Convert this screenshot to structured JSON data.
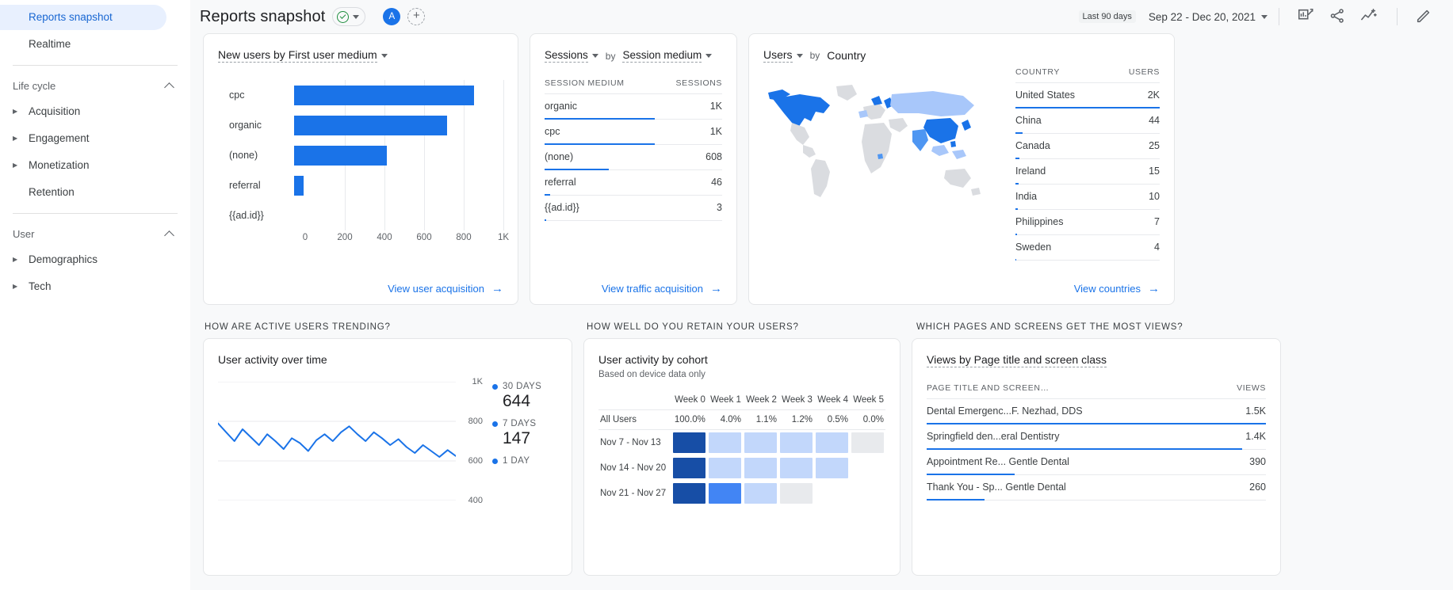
{
  "sidebar": {
    "top_items": [
      {
        "label": "Reports snapshot",
        "active": true,
        "expandable": false
      },
      {
        "label": "Realtime",
        "active": false,
        "expandable": false
      }
    ],
    "groups": [
      {
        "title": "Life cycle",
        "collapse_icon": "chevron-up-icon",
        "items": [
          {
            "label": "Acquisition",
            "expandable": true
          },
          {
            "label": "Engagement",
            "expandable": true
          },
          {
            "label": "Monetization",
            "expandable": true
          },
          {
            "label": "Retention",
            "expandable": false
          }
        ]
      },
      {
        "title": "User",
        "collapse_icon": "chevron-up-icon",
        "items": [
          {
            "label": "Demographics",
            "expandable": true
          },
          {
            "label": "Tech",
            "expandable": true
          }
        ]
      }
    ]
  },
  "header": {
    "title": "Reports snapshot",
    "badge_icon": "check-circle-icon",
    "badge_caret_icon": "triangle-down-icon",
    "avatar_initial": "A",
    "add_label": "+",
    "date_chip": "Last 90 days",
    "date_range": "Sep 22 - Dec 20, 2021",
    "date_caret_icon": "triangle-down-icon",
    "tools": [
      {
        "name": "compare-chart-icon"
      },
      {
        "name": "share-icon"
      },
      {
        "name": "insights-icon"
      },
      {
        "name": "edit-pencil-icon"
      }
    ]
  },
  "cards": {
    "new_users": {
      "title": "New users by First user medium",
      "caret_icon": "triangle-down-icon",
      "footer": "View user acquisition",
      "footer_arrow": "arrow-right-icon",
      "chart_data": {
        "type": "bar",
        "orientation": "horizontal",
        "title": "New users by First user medium",
        "xlabel": "",
        "ylabel": "",
        "categories": [
          "cpc",
          "organic",
          "(none)",
          "referral",
          "{{ad.id}}"
        ],
        "values": [
          860,
          730,
          445,
          47,
          0
        ],
        "xlim": [
          0,
          1000
        ],
        "xticks": [
          0,
          200,
          400,
          600,
          800,
          1000
        ],
        "xtick_labels": [
          "0",
          "200",
          "400",
          "600",
          "800",
          "1K"
        ],
        "grid": true,
        "color": "#1a73e8"
      }
    },
    "sessions": {
      "metric": "Sessions",
      "metric_caret_icon": "triangle-down-icon",
      "by": "by",
      "dimension": "Session medium",
      "dimension_caret_icon": "triangle-down-icon",
      "footer": "View traffic acquisition",
      "footer_arrow": "arrow-right-icon",
      "columns": [
        "SESSION MEDIUM",
        "SESSIONS"
      ],
      "rows": [
        {
          "label": "organic",
          "value": "1K",
          "pct": 62
        },
        {
          "label": "cpc",
          "value": "1K",
          "pct": 62
        },
        {
          "label": "(none)",
          "value": "608",
          "pct": 36
        },
        {
          "label": "referral",
          "value": "46",
          "pct": 3
        },
        {
          "label": "{{ad.id}}",
          "value": "3",
          "pct": 1
        }
      ]
    },
    "countries": {
      "metric": "Users",
      "metric_caret_icon": "triangle-down-icon",
      "by": "by",
      "dimension": "Country",
      "footer": "View countries",
      "footer_arrow": "arrow-right-icon",
      "columns": [
        "COUNTRY",
        "USERS"
      ],
      "rows": [
        {
          "label": "United States",
          "value": "2K",
          "pct": 100
        },
        {
          "label": "China",
          "value": "44",
          "pct": 5
        },
        {
          "label": "Canada",
          "value": "25",
          "pct": 3
        },
        {
          "label": "Ireland",
          "value": "15",
          "pct": 2
        },
        {
          "label": "India",
          "value": "10",
          "pct": 1.5
        },
        {
          "label": "Philippines",
          "value": "7",
          "pct": 1
        },
        {
          "label": "Sweden",
          "value": "4",
          "pct": 0.8
        }
      ],
      "map_icon": "world-map"
    }
  },
  "sections": [
    {
      "label": "HOW ARE ACTIVE USERS TRENDING?"
    },
    {
      "label": "HOW WELL DO YOU RETAIN YOUR USERS?"
    },
    {
      "label": "WHICH PAGES AND SCREENS GET THE MOST VIEWS?"
    }
  ],
  "user_activity": {
    "title": "User activity over time",
    "chart_data": {
      "type": "line",
      "title": "User activity over time",
      "xlabel": "",
      "ylabel": "",
      "ylim": [
        400,
        1000
      ],
      "yticks": [
        400,
        600,
        800,
        1000
      ],
      "ytick_labels": [
        "400",
        "600",
        "800",
        "1K"
      ],
      "grid": true,
      "color": "#1a73e8",
      "series": [
        {
          "name": "30 DAYS",
          "values": [
            790,
            745,
            700,
            760,
            720,
            680,
            735,
            700,
            660,
            715,
            690,
            650,
            705,
            735,
            700,
            745,
            775,
            735,
            700,
            745,
            715,
            680,
            710,
            670,
            640,
            680,
            650,
            620,
            655,
            625
          ]
        }
      ]
    },
    "legend": [
      {
        "name": "30 DAYS",
        "value": "644"
      },
      {
        "name": "7 DAYS",
        "value": "147"
      },
      {
        "name": "1 DAY",
        "value": ""
      }
    ]
  },
  "cohort": {
    "title": "User activity by cohort",
    "subtitle": "Based on device data only",
    "columns": [
      "",
      "Week 0",
      "Week 1",
      "Week 2",
      "Week 3",
      "Week 4",
      "Week 5"
    ],
    "all_users": {
      "label": "All Users",
      "values": [
        "100.0%",
        "4.0%",
        "1.1%",
        "1.2%",
        "0.5%",
        "0.0%"
      ]
    },
    "rows": [
      {
        "label": "Nov 7 - Nov 13",
        "intensities": [
          1.0,
          0.25,
          0.25,
          0.25,
          0.25,
          0.08
        ]
      },
      {
        "label": "Nov 14 - Nov 20",
        "intensities": [
          1.0,
          0.25,
          0.25,
          0.25,
          0.25,
          -1
        ]
      },
      {
        "label": "Nov 21 - Nov 27",
        "intensities": [
          1.0,
          0.55,
          0.3,
          0.12,
          -1,
          -1
        ]
      }
    ]
  },
  "page_views": {
    "title": "Views by Page title and screen class",
    "columns": [
      "PAGE TITLE AND SCREEN…",
      "VIEWS"
    ],
    "rows": [
      {
        "label": "Dental Emergenc...F. Nezhad, DDS",
        "value": "1.5K",
        "pct": 100
      },
      {
        "label": "Springfield den...eral Dentistry",
        "value": "1.4K",
        "pct": 93
      },
      {
        "label": "Appointment Re... Gentle Dental",
        "value": "390",
        "pct": 26
      },
      {
        "label": "Thank You - Sp... Gentle Dental",
        "value": "260",
        "pct": 17
      }
    ]
  },
  "colors": {
    "accent": "#1a73e8",
    "active_bg": "#e8f0fe",
    "active_text": "#1967d2",
    "page_bg": "#f8f9fa"
  }
}
